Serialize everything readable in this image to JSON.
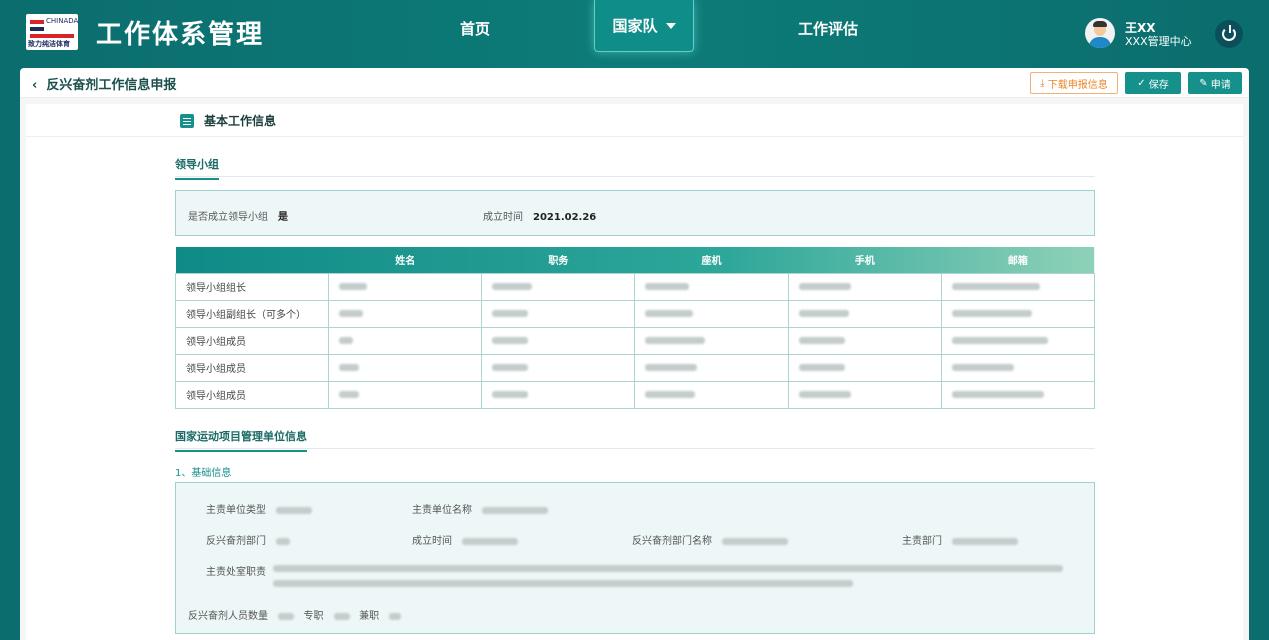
{
  "header": {
    "logo_text": "CHINADA",
    "logo_caption": "致力纯洁体育",
    "app_title": "工作体系管理",
    "nav": [
      {
        "label": "首页"
      },
      {
        "label": "国家队"
      },
      {
        "label": "工作评估"
      }
    ],
    "user": {
      "name": "王XX",
      "org": "XXX管理中心"
    }
  },
  "subbar": {
    "back_label": "反兴奋剂工作信息申报",
    "download_label": "下载申报信息",
    "save_label": "保存",
    "apply_label": "申请"
  },
  "section": {
    "title": "基本工作信息",
    "leadership_tab": "领导小组",
    "established_label": "是否成立领导小组",
    "established_value": "是",
    "founded_label": "成立时间",
    "founded_value": "2021.02.26",
    "table_headers": [
      "",
      "姓名",
      "职务",
      "座机",
      "手机",
      "邮箱"
    ],
    "table_rows": [
      {
        "role": "领导小组组长"
      },
      {
        "role": "领导小组副组长（可多个）"
      },
      {
        "role": "领导小组成员"
      },
      {
        "role": "领导小组成员"
      },
      {
        "role": "领导小组成员"
      }
    ],
    "unit_tab": "国家运动项目管理单位信息",
    "basic_step": "1、基础信息",
    "fields": {
      "unit_type": "主责单位类型",
      "unit_name": "主责单位名称",
      "dept": "反兴奋剂部门",
      "dept_founded": "成立时间",
      "dept_name": "反兴奋剂部门名称",
      "main_dept": "主责部门",
      "duty": "主责处室职责",
      "staff_count": "反兴奋剂人员数量",
      "full_time": "专职",
      "part_time": "兼职"
    }
  },
  "colors": {
    "accent": "#15908a",
    "header_bg": "#0d7c79",
    "download": "#e8862a"
  }
}
